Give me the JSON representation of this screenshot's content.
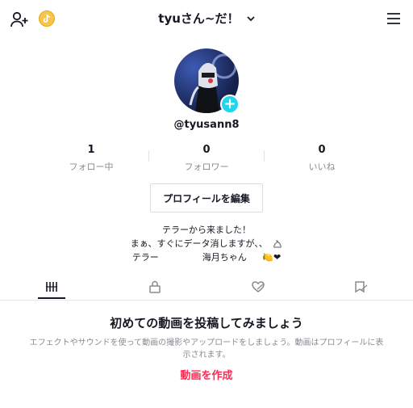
{
  "header": {
    "title": "tyuさん~だ！",
    "icons": [
      "add-friend-icon",
      "tiktok-coin-icon",
      "chevron-down-icon",
      "menu-icon"
    ]
  },
  "profile": {
    "username": "@tyusann8",
    "avatar_plus": "+"
  },
  "stats": [
    {
      "value": "1",
      "label": "フォロー中"
    },
    {
      "value": "0",
      "label": "フォロワー"
    },
    {
      "value": "0",
      "label": "いいね"
    }
  ],
  "edit_button": "プロフィールを編集",
  "bio": {
    "line1": "テラーから来ました！",
    "line2": "まぁ、すぐにデータ消しますが、、",
    "line3_a": "テラー",
    "line3_b": "海月ちゃん",
    "line3_emoji": "🍋❤"
  },
  "tabs": [
    "videos-grid-icon",
    "lock-icon",
    "liked-hidden-icon",
    "bookmark-icon"
  ],
  "empty": {
    "title": "初めての動画を投稿してみましょう",
    "desc": "エフェクトやサウンドを使って動画の撮影やアップロードをしましょう。動画はプロフィールに表示されます。",
    "link": "動画を作成"
  },
  "colors": {
    "accent": "#fe2c55",
    "plus": "#20d5ec",
    "coin": "#f5c64a"
  }
}
